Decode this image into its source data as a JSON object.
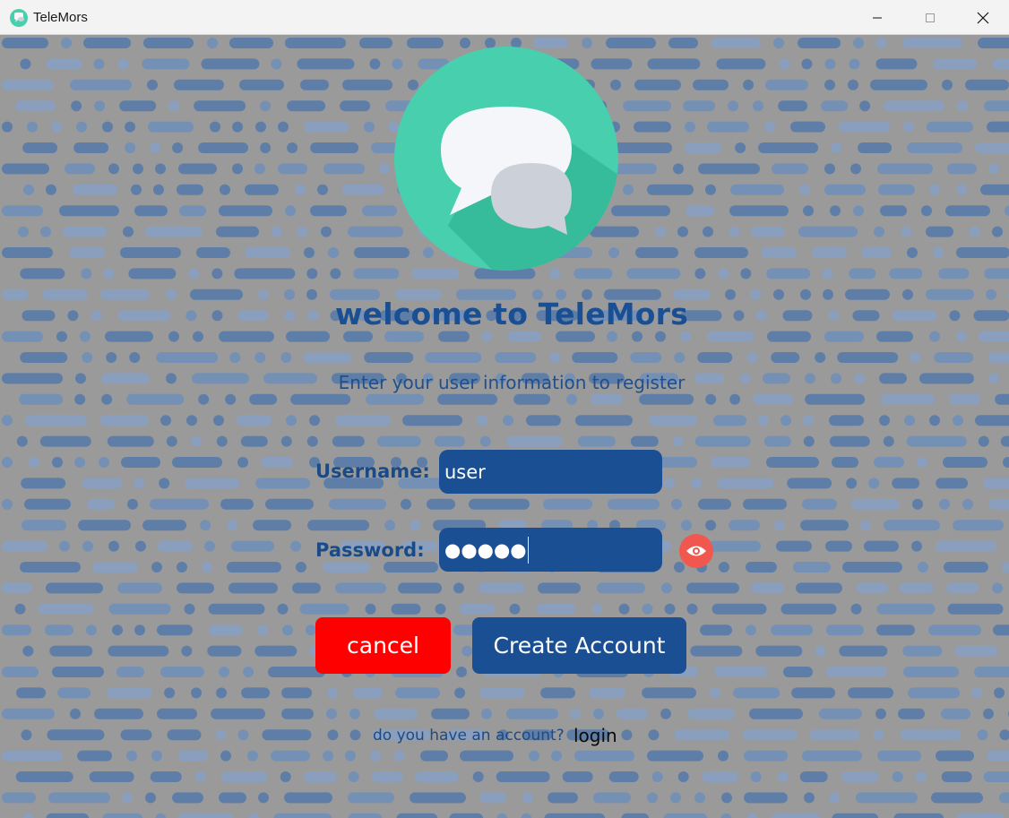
{
  "window": {
    "title": "TeleMors",
    "minimize": "─",
    "maximize": "☐",
    "close": "✕",
    "app_icon": "chat-bubble-icon"
  },
  "header": {
    "logo": "telemors-chat-logo",
    "welcome": "welcome to TeleMors",
    "subtitle": "Enter your user information to register"
  },
  "form": {
    "username_label": "Username:",
    "username_value": "user",
    "password_label": "Password:",
    "password_value": "●●●●●",
    "password_toggle_icon": "eye-icon"
  },
  "actions": {
    "cancel_label": "cancel",
    "create_label": "Create Account"
  },
  "footer": {
    "question": "do you have an account?",
    "login_label": "login"
  },
  "colors": {
    "primary": "#1a4f93",
    "cancel": "#ff0000",
    "eye_button": "#f0584f",
    "logo_circle": "#48cfad",
    "background": "#9a9a9a"
  }
}
